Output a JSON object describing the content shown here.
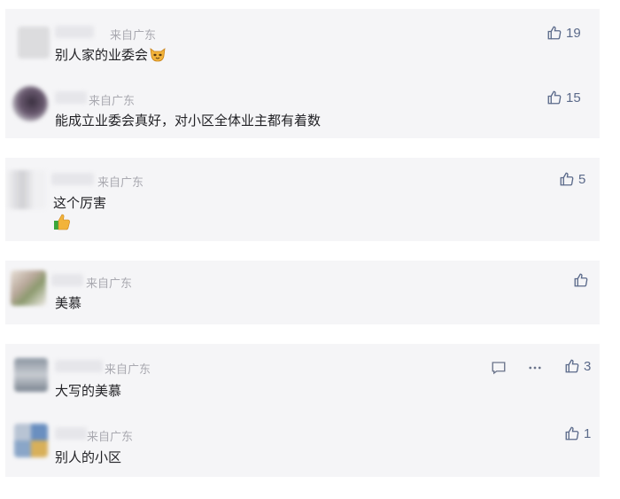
{
  "icons": {
    "like": "thumbs-up-icon",
    "reply": "comment-bubble-icon",
    "more": "more-dots-icon",
    "cat_emoji": "cat-face-emoji",
    "thumb_emoji": "thumbs-up-emoji"
  },
  "colors": {
    "card_bg": "#f5f5f7",
    "like_icon": "#5b6a8a",
    "location_text": "#a9a9b0",
    "body_text": "#222226"
  },
  "comments": [
    {
      "location": "来自广东",
      "text": "别人家的业委会",
      "emoji": "cat-face-emoji",
      "likes": "19"
    },
    {
      "location": "来自广东",
      "text": "能成立业委会真好，对小区全体业主都有着数",
      "likes": "15"
    },
    {
      "location": "来自广东",
      "text": "这个厉害",
      "emoji": "thumbs-up-emoji",
      "likes": "5"
    },
    {
      "location": "来自广东",
      "text": "美慕",
      "likes": ""
    },
    {
      "location": "来自广东",
      "text": "大写的美慕",
      "likes": "3"
    },
    {
      "location": "来自广东",
      "text": "别人的小区",
      "likes": "1"
    }
  ]
}
